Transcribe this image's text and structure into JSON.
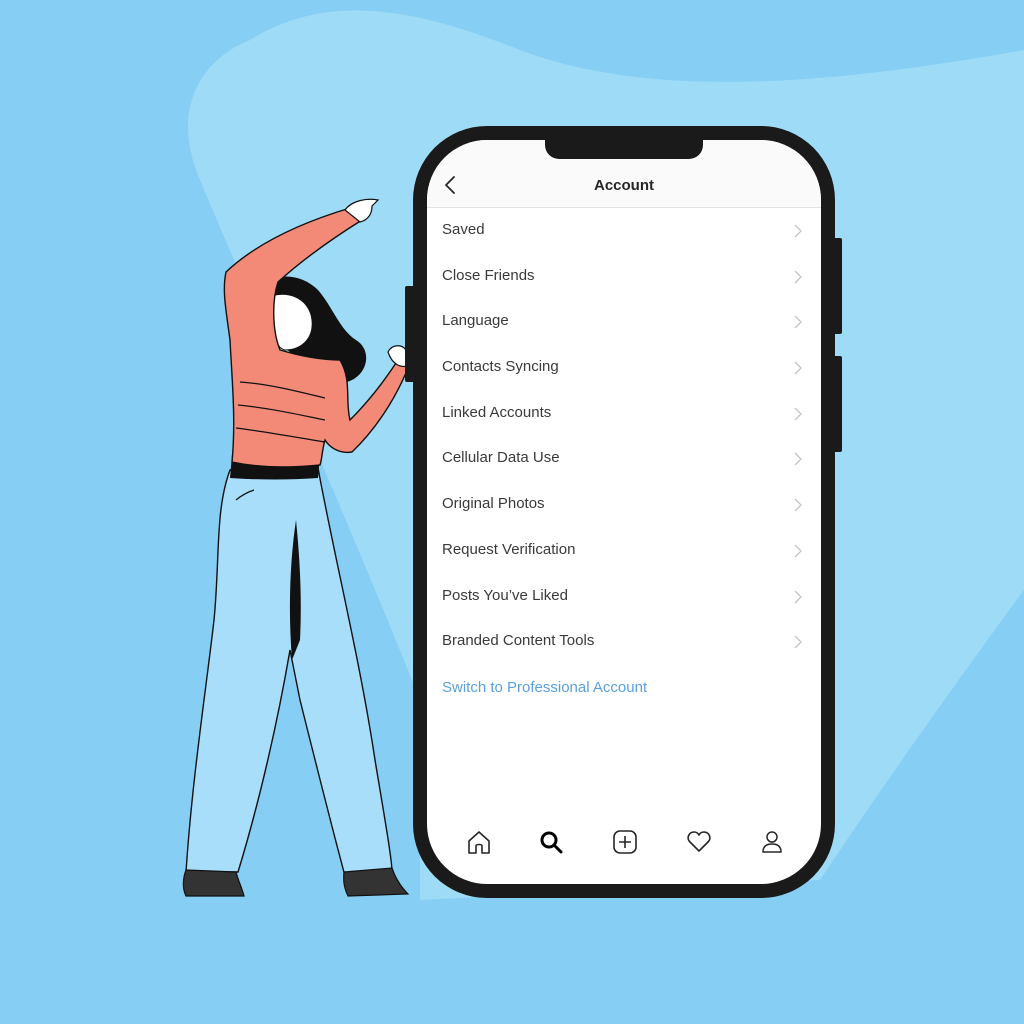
{
  "header": {
    "title": "Account",
    "back_icon": "chevron-left-icon"
  },
  "menu": {
    "items": [
      {
        "label": "Saved",
        "icon": "chevron-right-icon"
      },
      {
        "label": "Close Friends",
        "icon": "chevron-right-icon"
      },
      {
        "label": "Language",
        "icon": "chevron-right-icon"
      },
      {
        "label": "Contacts Syncing",
        "icon": "chevron-right-icon"
      },
      {
        "label": "Linked Accounts",
        "icon": "chevron-right-icon"
      },
      {
        "label": "Cellular Data Use",
        "icon": "chevron-right-icon"
      },
      {
        "label": "Original Photos",
        "icon": "chevron-right-icon"
      },
      {
        "label": "Request Verification",
        "icon": "chevron-right-icon"
      },
      {
        "label": "Posts You’ve Liked",
        "icon": "chevron-right-icon"
      },
      {
        "label": "Branded Content Tools",
        "icon": "chevron-right-icon"
      }
    ],
    "pro_link": "Switch to Professional Account"
  },
  "tabbar": {
    "tabs": [
      {
        "name": "home",
        "icon": "home-icon",
        "active": false
      },
      {
        "name": "search",
        "icon": "search-icon",
        "active": true
      },
      {
        "name": "new-post",
        "icon": "plus-square-icon",
        "active": false
      },
      {
        "name": "activity",
        "icon": "heart-icon",
        "active": false
      },
      {
        "name": "profile",
        "icon": "user-icon",
        "active": false
      }
    ]
  },
  "colors": {
    "background": "#86cef3",
    "background_light": "#9ddbf6",
    "phone_frame": "#1a1a1a",
    "link": "#5b9fdc",
    "text": "#3a3a3a",
    "sweater": "#f38a78",
    "pants": "#a8defa"
  }
}
